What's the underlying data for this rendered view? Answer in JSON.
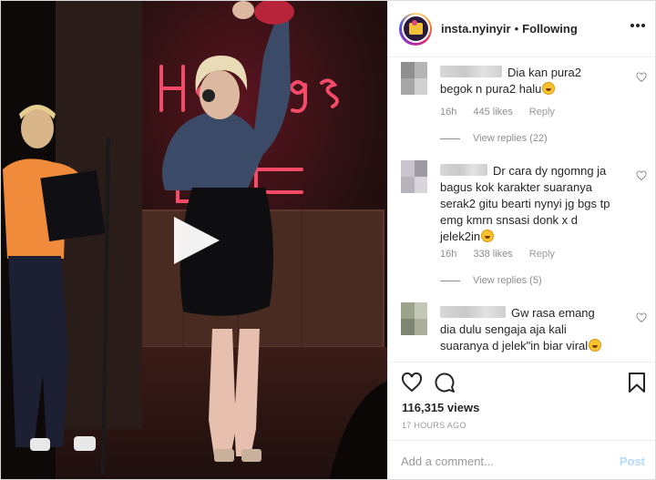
{
  "header": {
    "username": "insta.nyinyir",
    "separator": "•",
    "follow_state": "Following"
  },
  "comments": [
    {
      "text": "Dia kan pura2 begok n pura2 halu",
      "time": "16h",
      "likes": "445 likes",
      "reply_label": "Reply",
      "view_replies": "View replies (22)"
    },
    {
      "text": "Dr cara dy ngomng ja bagus kok karakter suaranya serak2 gitu bearti nynyi jg bgs tp emg kmrn snsasi donk x d jelek2in",
      "time": "16h",
      "likes": "338 likes",
      "reply_label": "Reply",
      "view_replies": "View replies (5)"
    },
    {
      "text": "Gw rasa emang dia dulu sengaja aja kali suaranya d jelek\"in biar viral"
    }
  ],
  "stats": {
    "views": "116,315 views",
    "time_ago": "17 HOURS AGO"
  },
  "composer": {
    "placeholder": "Add a comment...",
    "post_label": "Post"
  },
  "icons": {
    "more": "more-options-icon",
    "like": "heart-icon",
    "comment": "comment-icon",
    "save": "bookmark-icon",
    "play": "play-icon"
  }
}
